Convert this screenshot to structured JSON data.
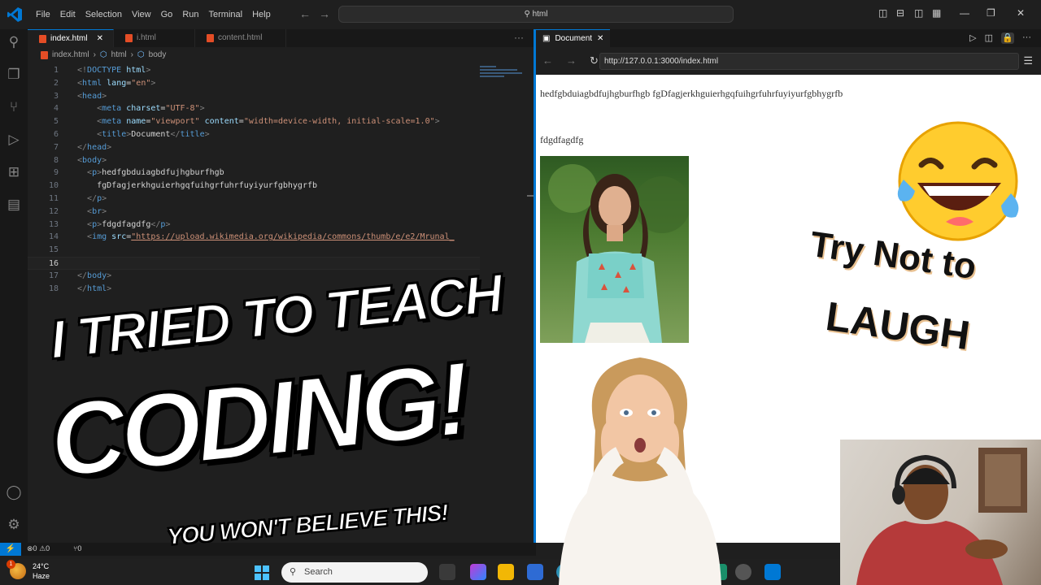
{
  "menu": [
    "File",
    "Edit",
    "Selection",
    "View",
    "Go",
    "Run",
    "Terminal",
    "Help"
  ],
  "search": "html",
  "editor": {
    "tabs": [
      {
        "label": "index.html",
        "active": true
      },
      {
        "label": "i.html",
        "active": false
      },
      {
        "label": "content.html",
        "active": false
      }
    ],
    "breadcrumb": [
      "index.html",
      "html",
      "body"
    ],
    "line_numbers": [
      "1",
      "2",
      "3",
      "4",
      "5",
      "6",
      "7",
      "8",
      "9",
      "10",
      "11",
      "12",
      "13",
      "14",
      "15",
      "16",
      "17",
      "18"
    ],
    "current_line": "16"
  },
  "browser": {
    "tab_title": "Document",
    "url": "http://127.0.0.1:3000/index.html",
    "para1": "hedfgbduiagbdfujhgburfhgb fgDfagjerkhguierhgqfuihgrfuhrfuyiyurfgbhygrfb",
    "para2": "fdgdfagdfg"
  },
  "status": {
    "errors": "0",
    "warnings": "0",
    "ports": "0"
  },
  "taskbar": {
    "temp": "24°C",
    "weather": "Haze",
    "badge": "1",
    "search_placeholder": "Search"
  },
  "overlay": {
    "line1": "I TRIED TO TEACH",
    "line2": "CODING!",
    "line3": "YOU WON'T BELIEVE THIS!",
    "try_line1": "Try Not to",
    "try_line2": "LAUGH"
  },
  "colors": {
    "accent": "#0078d4",
    "tag": "#569cd6",
    "attribute": "#9cdcfe",
    "string": "#ce9178"
  }
}
